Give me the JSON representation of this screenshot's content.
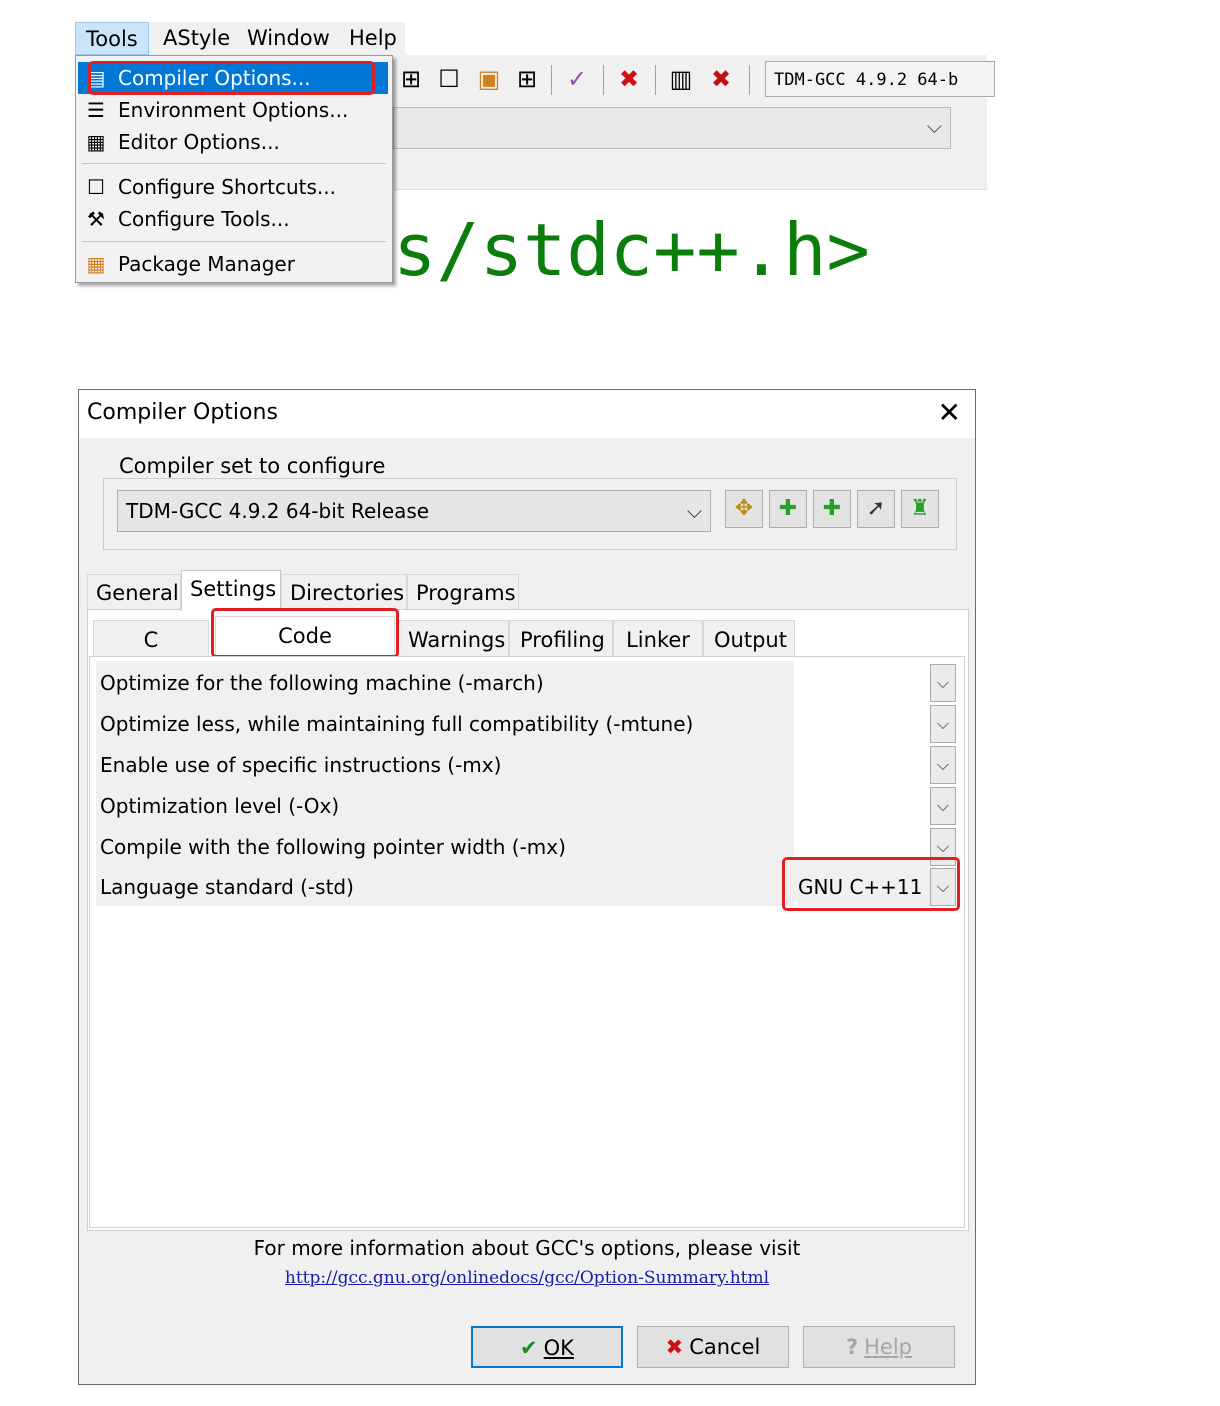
{
  "menubar": {
    "items": [
      "Tools",
      "AStyle",
      "Window",
      "Help"
    ]
  },
  "tools_menu": {
    "items": [
      {
        "label": "Compiler Options...",
        "icon": "compiler-options-icon",
        "selected": true
      },
      {
        "label": "Environment Options...",
        "icon": "environment-options-icon"
      },
      {
        "label": "Editor Options...",
        "icon": "editor-options-icon"
      },
      {
        "label": "Configure Shortcuts...",
        "icon": "shortcuts-icon"
      },
      {
        "label": "Configure Tools...",
        "icon": "tools-icon"
      },
      {
        "label": "Package Manager",
        "icon": "package-manager-icon"
      }
    ]
  },
  "toolbar": {
    "compiler_display": "TDM-GCC 4.9.2 64-b"
  },
  "editor": {
    "code_fragment": "s/stdc++.h>"
  },
  "dialog": {
    "title": "Compiler Options",
    "compiler_set_label": "Compiler set to configure",
    "compiler_set_value": "TDM-GCC 4.9.2 64-bit Release",
    "tabs": [
      "General",
      "Settings",
      "Directories",
      "Programs"
    ],
    "active_tab": "Settings",
    "subtabs": [
      "C options",
      "Code Generation",
      "Warnings",
      "Profiling",
      "Linker",
      "Output"
    ],
    "active_subtab": "Code Generation",
    "options": [
      {
        "label": "Optimize for the following machine (-march)",
        "value": ""
      },
      {
        "label": "Optimize less, while maintaining full compatibility (-mtune)",
        "value": ""
      },
      {
        "label": "Enable use of specific instructions (-mx)",
        "value": ""
      },
      {
        "label": "Optimization level (-Ox)",
        "value": ""
      },
      {
        "label": "Compile with the following pointer width (-mx)",
        "value": ""
      },
      {
        "label": "Language standard (-std)",
        "value": "GNU C++11"
      }
    ],
    "info_text": "For more information about GCC's options, please visit",
    "info_link": "http://gcc.gnu.org/onlinedocs/gcc/Option-Summary.html",
    "buttons": {
      "ok": "OK",
      "cancel": "Cancel",
      "help": "Help"
    }
  },
  "colors": {
    "highlight_red": "#e02020",
    "menu_selected": "#0078d7",
    "code_green": "#0a7d0a"
  }
}
